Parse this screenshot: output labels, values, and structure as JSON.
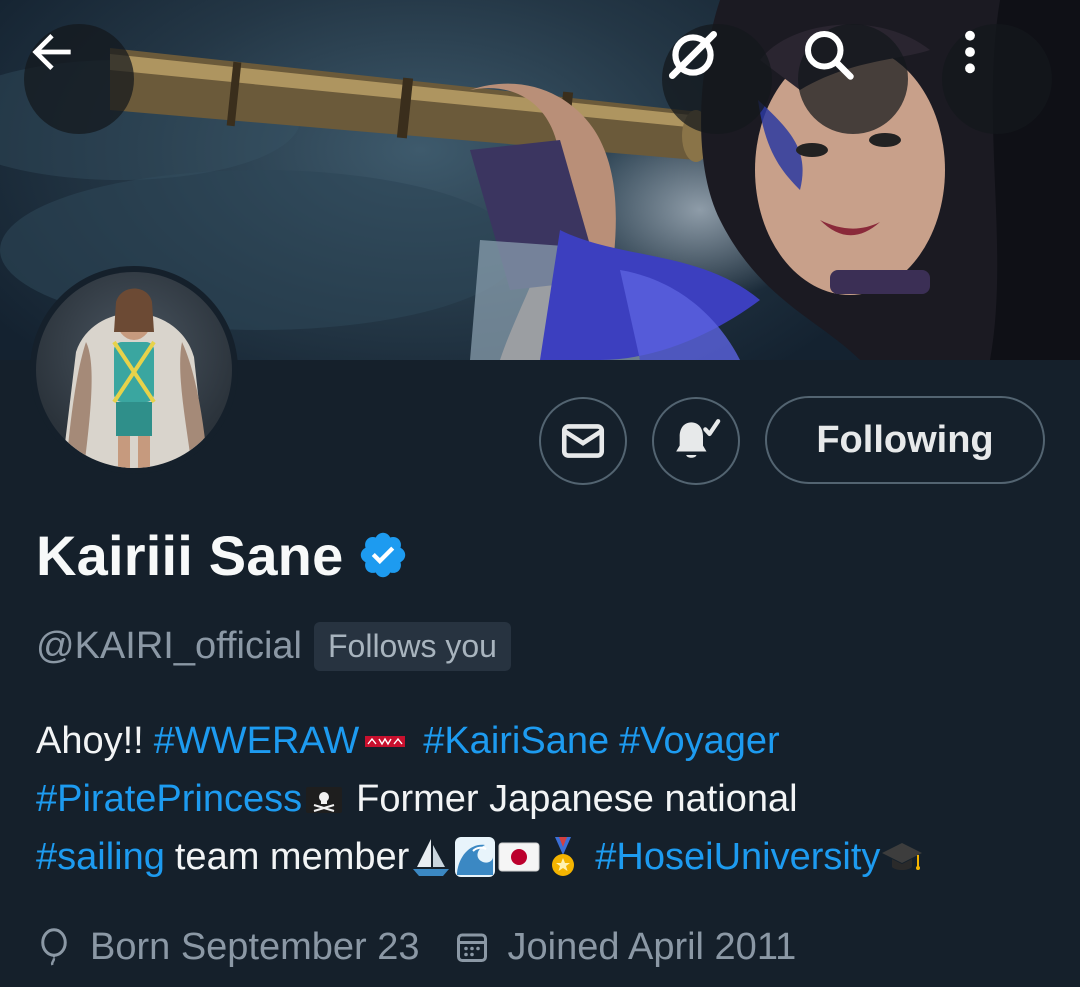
{
  "header": {
    "back_icon": "arrow-left-icon",
    "grok_icon": "grok-slash-icon",
    "search_icon": "search-icon",
    "more_icon": "more-vertical-icon"
  },
  "actions": {
    "message_icon": "mail-icon",
    "notify_icon": "bell-check-icon",
    "following_label": "Following"
  },
  "profile": {
    "display_name": "Kairiii Sane",
    "verified": true,
    "handle": "@KAIRI_official",
    "follows_you": "Follows you"
  },
  "bio": {
    "line1": {
      "text": "Ahoy!!",
      "tag1": "#WWERAW",
      "tag2": "#KairiSane",
      "tag3": "#Voyager"
    },
    "line2": {
      "tag": "#PiratePrincess",
      "text": "Former Japanese national"
    },
    "line3": {
      "tag1": "#sailing",
      "text": "team member",
      "tag2": "#HoseiUniversity"
    }
  },
  "meta": {
    "birthday": "Born September 23",
    "joined": "Joined April 2011"
  },
  "colors": {
    "background": "#15202b",
    "link": "#1d9bf0",
    "secondary_text": "#8b98a5",
    "border": "#536471"
  }
}
